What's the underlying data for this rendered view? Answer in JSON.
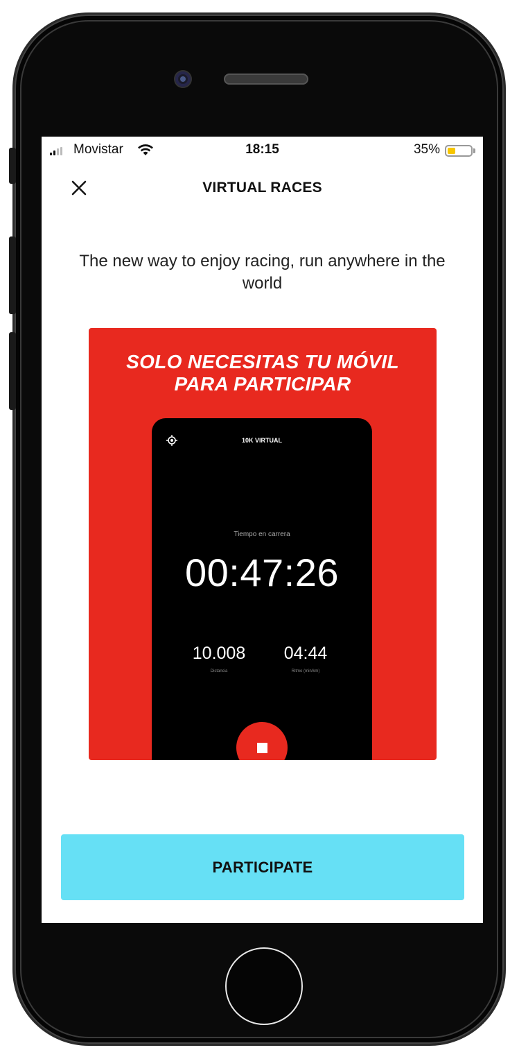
{
  "status_bar": {
    "carrier": "Movistar",
    "time": "18:15",
    "battery_percent": "35%",
    "battery_level": 0.35,
    "battery_color": "#f7c600",
    "signal_icon": "signal-bars-icon",
    "wifi_icon": "wifi-icon"
  },
  "nav": {
    "close_icon": "close-icon",
    "title": "VIRTUAL RACES"
  },
  "subtitle": "The new way to enjoy racing, run anywhere in the world",
  "promo": {
    "heading_line1": "SOLO NECESITAS TU MÓVIL",
    "heading_line2": "PARA PARTICIPAR",
    "background_color": "#e8291f",
    "mock_screen": {
      "gps_icon": "gps-icon",
      "race_name": "10K VIRTUAL",
      "time_label": "Tiempo en carrera",
      "time": "00:47:26",
      "distance_value": "10.008",
      "distance_label": "Distancia",
      "pace_value": "04:44",
      "pace_label": "Ritmo (min/km)",
      "stop_icon": "stop-icon"
    }
  },
  "participate_button": {
    "label": "PARTICIPATE",
    "color": "#66e0f5"
  }
}
